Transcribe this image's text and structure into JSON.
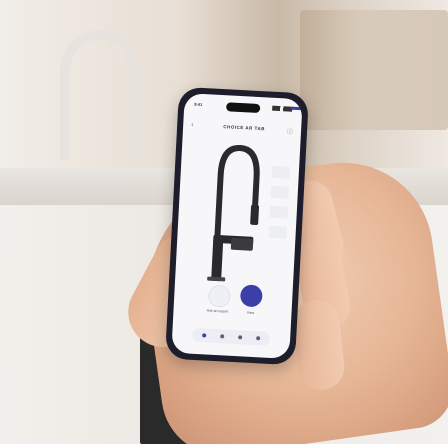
{
  "photo": {
    "subject": "hand-holding-smartphone",
    "background": "kitchen"
  },
  "app": {
    "title": "CHOICE AR TAB",
    "status_time": "9:41",
    "back_icon": "chevron-left-icon",
    "info_icon": "info-icon",
    "product": "faucet-3d-model",
    "options": [
      "",
      "",
      "",
      ""
    ],
    "controls": [
      {
        "icon": "camera-icon",
        "label": "Ask an expert",
        "color": "#eef0f6"
      },
      {
        "icon": "ar-icon",
        "label": "View",
        "color": "#3b40a8"
      }
    ],
    "nav_icons": [
      "home-icon",
      "cart-icon",
      "heart-icon",
      "user-icon"
    ],
    "accent_color": "#3b40a8"
  }
}
